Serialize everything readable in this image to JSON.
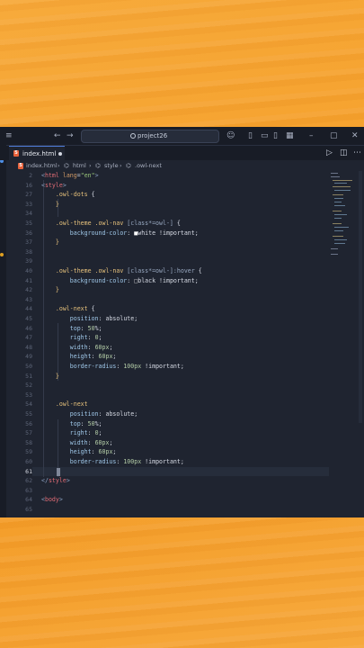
{
  "titlebar": {
    "search_text": "project26",
    "menu_icon": "≡",
    "back_icon": "←",
    "forward_icon": "→",
    "copilot_icon": "☺",
    "layout_icons": [
      "▯",
      "▭",
      "▯",
      "▦"
    ],
    "window_controls": [
      "–",
      "▢",
      "✕"
    ]
  },
  "tab": {
    "label": "index.html"
  },
  "editor_actions": {
    "run": "▷",
    "split": "◫",
    "more": "⋯"
  },
  "breadcrumb": {
    "file": "index.html",
    "sep": "›",
    "html": "html",
    "style": "style",
    "selector": ".owl-next"
  },
  "code_lines": [
    {
      "n": "2",
      "segs": [
        [
          "<",
          "#8ea3c4"
        ],
        [
          "html",
          "#e06c75"
        ],
        [
          " lang",
          "#d19a66"
        ],
        [
          "=",
          "#d6dae4"
        ],
        [
          "\"en\"",
          "#98c379"
        ],
        [
          ">",
          "#8ea3c4"
        ]
      ]
    },
    {
      "n": "16",
      "segs": [
        [
          "<",
          "#8ea3c4"
        ],
        [
          "style",
          "#e06c75"
        ],
        [
          ">",
          "#8ea3c4"
        ]
      ]
    },
    {
      "n": "27",
      "segs": [
        [
          "    ",
          ""
        ],
        [
          ".owl-dots",
          "#e5c07b"
        ],
        [
          " {",
          "#d6dae4"
        ]
      ]
    },
    {
      "n": "33",
      "segs": [
        [
          "    }",
          "#e5c07b"
        ]
      ]
    },
    {
      "n": "34",
      "segs": []
    },
    {
      "n": "35",
      "segs": [
        [
          "    ",
          ""
        ],
        [
          ".owl-theme .owl-nav ",
          "#e5c07b"
        ],
        [
          "[class*=owl-]",
          "#98a8c0"
        ],
        [
          " {",
          "#d6dae4"
        ]
      ]
    },
    {
      "n": "36",
      "segs": [
        [
          "        background-color",
          "#9fc7e8"
        ],
        [
          ": ",
          "#d6dae4"
        ],
        [
          "■",
          "#ffffff"
        ],
        [
          "white !important",
          "#d6dae4"
        ],
        [
          ";",
          "#d6dae4"
        ]
      ]
    },
    {
      "n": "37",
      "segs": [
        [
          "    }",
          "#e5c07b"
        ]
      ]
    },
    {
      "n": "38",
      "segs": []
    },
    {
      "n": "39",
      "segs": []
    },
    {
      "n": "40",
      "segs": [
        [
          "    ",
          ""
        ],
        [
          ".owl-theme .owl-nav ",
          "#e5c07b"
        ],
        [
          "[class*=owl-]:hover",
          "#98a8c0"
        ],
        [
          " {",
          "#d6dae4"
        ]
      ]
    },
    {
      "n": "41",
      "segs": [
        [
          "        background-color",
          "#9fc7e8"
        ],
        [
          ": ",
          "#d6dae4"
        ],
        [
          "□",
          "#cccccc"
        ],
        [
          "black !important",
          "#d6dae4"
        ],
        [
          ";",
          "#d6dae4"
        ]
      ]
    },
    {
      "n": "42",
      "segs": [
        [
          "    }",
          "#e5c07b"
        ]
      ]
    },
    {
      "n": "43",
      "segs": []
    },
    {
      "n": "44",
      "segs": [
        [
          "    ",
          ""
        ],
        [
          ".owl-next",
          "#e5c07b"
        ],
        [
          " {",
          "#d6dae4"
        ]
      ]
    },
    {
      "n": "45",
      "segs": [
        [
          "        position",
          "#9fc7e8"
        ],
        [
          ": absolute;",
          "#d6dae4"
        ]
      ]
    },
    {
      "n": "46",
      "segs": [
        [
          "        top",
          "#9fc7e8"
        ],
        [
          ": ",
          "#d6dae4"
        ],
        [
          "50",
          "#b5cea8"
        ],
        [
          "%;",
          "#d6dae4"
        ]
      ]
    },
    {
      "n": "47",
      "segs": [
        [
          "        right",
          "#9fc7e8"
        ],
        [
          ": ",
          "#d6dae4"
        ],
        [
          "0",
          "#b5cea8"
        ],
        [
          ";",
          "#d6dae4"
        ]
      ]
    },
    {
      "n": "48",
      "segs": [
        [
          "        width",
          "#9fc7e8"
        ],
        [
          ": ",
          "#d6dae4"
        ],
        [
          "60px",
          "#b5cea8"
        ],
        [
          ";",
          "#d6dae4"
        ]
      ]
    },
    {
      "n": "49",
      "segs": [
        [
          "        height",
          "#9fc7e8"
        ],
        [
          ": ",
          "#d6dae4"
        ],
        [
          "60px",
          "#b5cea8"
        ],
        [
          ";",
          "#d6dae4"
        ]
      ]
    },
    {
      "n": "50",
      "segs": [
        [
          "        border-radius",
          "#9fc7e8"
        ],
        [
          ": ",
          "#d6dae4"
        ],
        [
          "100px",
          "#b5cea8"
        ],
        [
          " !important;",
          "#d6dae4"
        ]
      ]
    },
    {
      "n": "51",
      "segs": [
        [
          "    }",
          "#e5c07b"
        ]
      ]
    },
    {
      "n": "52",
      "segs": []
    },
    {
      "n": "53",
      "segs": []
    },
    {
      "n": "54",
      "segs": [
        [
          "    ",
          ""
        ],
        [
          ".owl-next",
          "#e5c07b"
        ],
        [
          " ",
          "#d6dae4"
        ]
      ]
    },
    {
      "n": "55",
      "segs": [
        [
          "        position",
          "#9fc7e8"
        ],
        [
          ": absolute;",
          "#d6dae4"
        ]
      ]
    },
    {
      "n": "56",
      "segs": [
        [
          "        top",
          "#9fc7e8"
        ],
        [
          ": ",
          "#d6dae4"
        ],
        [
          "50",
          "#b5cea8"
        ],
        [
          "%;",
          "#d6dae4"
        ]
      ]
    },
    {
      "n": "57",
      "segs": [
        [
          "        right",
          "#9fc7e8"
        ],
        [
          ": ",
          "#d6dae4"
        ],
        [
          "0",
          "#b5cea8"
        ],
        [
          ";",
          "#d6dae4"
        ]
      ]
    },
    {
      "n": "58",
      "segs": [
        [
          "        width",
          "#9fc7e8"
        ],
        [
          ": ",
          "#d6dae4"
        ],
        [
          "60px",
          "#b5cea8"
        ],
        [
          ";",
          "#d6dae4"
        ]
      ]
    },
    {
      "n": "59",
      "segs": [
        [
          "        height",
          "#9fc7e8"
        ],
        [
          ": ",
          "#d6dae4"
        ],
        [
          "60px",
          "#b5cea8"
        ],
        [
          ";",
          "#d6dae4"
        ]
      ]
    },
    {
      "n": "60",
      "segs": [
        [
          "        border-radius",
          "#9fc7e8"
        ],
        [
          ": ",
          "#d6dae4"
        ],
        [
          "100px",
          "#b5cea8"
        ],
        [
          " !important;",
          "#d6dae4"
        ]
      ]
    },
    {
      "n": "61",
      "segs": []
    },
    {
      "n": "62",
      "segs": [
        [
          "</",
          "#8ea3c4"
        ],
        [
          "style",
          "#e06c75"
        ],
        [
          ">",
          "#8ea3c4"
        ]
      ]
    },
    {
      "n": "63",
      "segs": []
    },
    {
      "n": "64",
      "segs": [
        [
          "<",
          "#8ea3c4"
        ],
        [
          "body",
          "#e06c75"
        ],
        [
          ">",
          "#8ea3c4"
        ]
      ]
    },
    {
      "n": "65",
      "segs": []
    }
  ],
  "active_line": "61"
}
